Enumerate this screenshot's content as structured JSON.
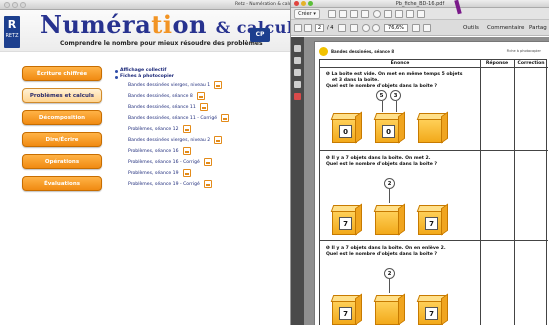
{
  "left_window": {
    "title": "Retz - Numération & calcul",
    "logo_text": "RETZ",
    "title_main_1": "Numéra",
    "title_main_2": "ti",
    "title_main_3": "on",
    "title_main_4": "& calcul",
    "subtitle": "Comprendre le nombre pour mieux résoudre des problèmes",
    "badge": "CP",
    "nav": [
      "Écriture chiffrée",
      "Problèmes et calculs",
      "Décomposition",
      "Dire/Écrire",
      "Opérations",
      "Évaluations"
    ],
    "tree_top_1": "Affichage collectif",
    "tree_top_2": "Fiches à photocopier",
    "tree_items": [
      "Bandes dessinées vierges, niveau 1",
      "Bandes dessinées, séance 8",
      "Bandes dessinées, séance 11",
      "Bandes dessinées, séance 11 - Corrigé",
      "Problèmes, séance 12",
      "Bandes dessinées vierges, niveau 2",
      "Problèmes, séance 16",
      "Problèmes, séance 16 - Corrigé",
      "Problèmes, séance 19",
      "Problèmes, séance 19 - Corrigé"
    ]
  },
  "right_window": {
    "title": "Pb_fiche_BD-16.pdf",
    "create_label": "Créer",
    "page_current": "2",
    "page_total": "4",
    "zoom": "76,6%",
    "menu_tools": "Outils",
    "menu_comment": "Commentaire",
    "menu_share": "Partag",
    "doc_header": "Bandes dessinées, séance 8",
    "doc_header_right": "Fiche à photocopier",
    "col_enonce": "Énonce",
    "col_reponse": "Réponse",
    "col_correction": "Correction",
    "q1_line1": "La boîte est vide. On met en même temps 5 objets",
    "q1_line2": "et 3 dans la boîte.",
    "q1_line3": "Quel est le nombre d'objets dans la boîte ?",
    "q1_values": [
      "0",
      "5",
      "3",
      "0"
    ],
    "q2_line1": "Il y a 7 objets dans la boîte. On met 2.",
    "q2_line2": "Quel est le nombre d'objets dans la boîte ?",
    "q2_values": [
      "7",
      "2",
      "7"
    ],
    "q3_line1": "Il y a 7 objets dans la boîte. On en enlève 2.",
    "q3_line2": "Quel est le nombre d'objets dans la boîte ?",
    "q3_values": [
      "7",
      "2",
      "7"
    ],
    "bullet": "❶"
  }
}
